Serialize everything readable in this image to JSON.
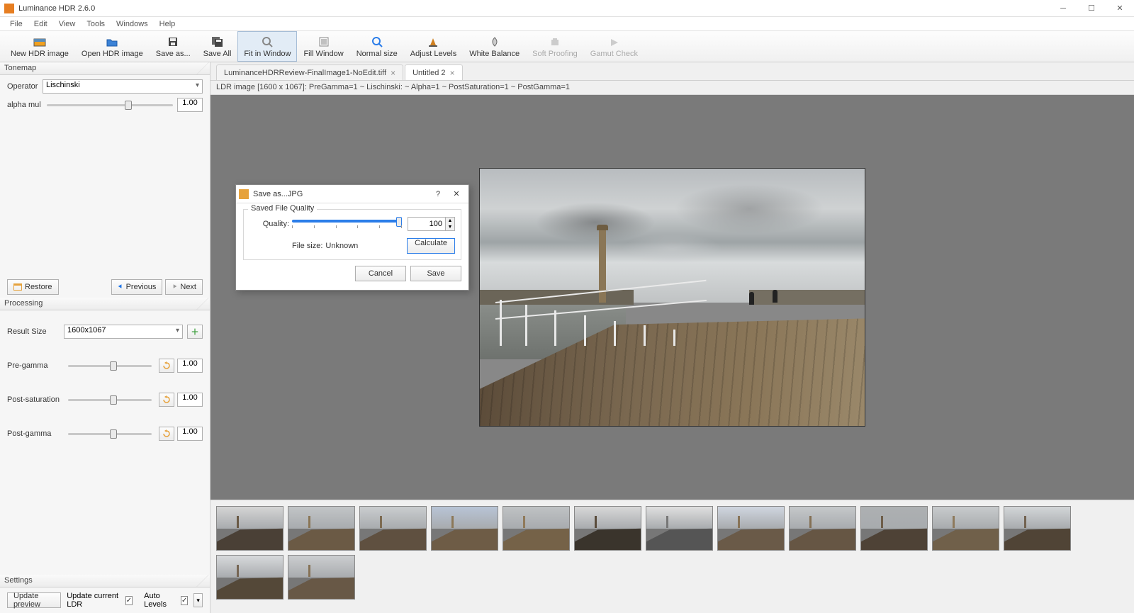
{
  "title": "Luminance HDR 2.6.0",
  "menu": {
    "file": "File",
    "edit": "Edit",
    "view": "View",
    "tools": "Tools",
    "windows": "Windows",
    "help": "Help"
  },
  "toolbar": {
    "new_hdr": "New HDR image",
    "open_hdr": "Open HDR image",
    "save_as": "Save as...",
    "save_all": "Save All",
    "fit_window": "Fit in Window",
    "fill_window": "Fill Window",
    "normal_size": "Normal size",
    "adjust_levels": "Adjust Levels",
    "white_balance": "White Balance",
    "soft_proofing": "Soft Proofing",
    "gamut_check": "Gamut Check"
  },
  "tonemap": {
    "heading": "Tonemap",
    "operator_label": "Operator",
    "operator_value": "Lischinski",
    "alpha_label": "alpha mul",
    "alpha_value": "1.00",
    "restore": "Restore",
    "previous": "Previous",
    "next": "Next"
  },
  "processing": {
    "heading": "Processing",
    "result_size_label": "Result Size",
    "result_size_value": "1600x1067",
    "pre_gamma_label": "Pre-gamma",
    "pre_gamma_value": "1.00",
    "post_sat_label": "Post-saturation",
    "post_sat_value": "1.00",
    "post_gamma_label": "Post-gamma",
    "post_gamma_value": "1.00"
  },
  "settings": {
    "heading": "Settings",
    "update_preview": "Update preview",
    "update_current_ldr": "Update current LDR",
    "auto_levels": "Auto Levels"
  },
  "tabs": {
    "tab1": "LuminanceHDRReview-FinalImage1-NoEdit.tiff",
    "tab2": "Untitled 2"
  },
  "info_line": "LDR image [1600 x 1067]: PreGamma=1 ~ Lischinski: ~ Alpha=1 ~ PostSaturation=1 ~ PostGamma=1",
  "dialog": {
    "title": "Save as...JPG",
    "group_title": "Saved File Quality",
    "quality_label": "Quality:",
    "quality_value": "100",
    "file_size_label": "File size:",
    "file_size_value": "Unknown",
    "calculate": "Calculate",
    "cancel": "Cancel",
    "save": "Save"
  },
  "thumb_count": 14
}
